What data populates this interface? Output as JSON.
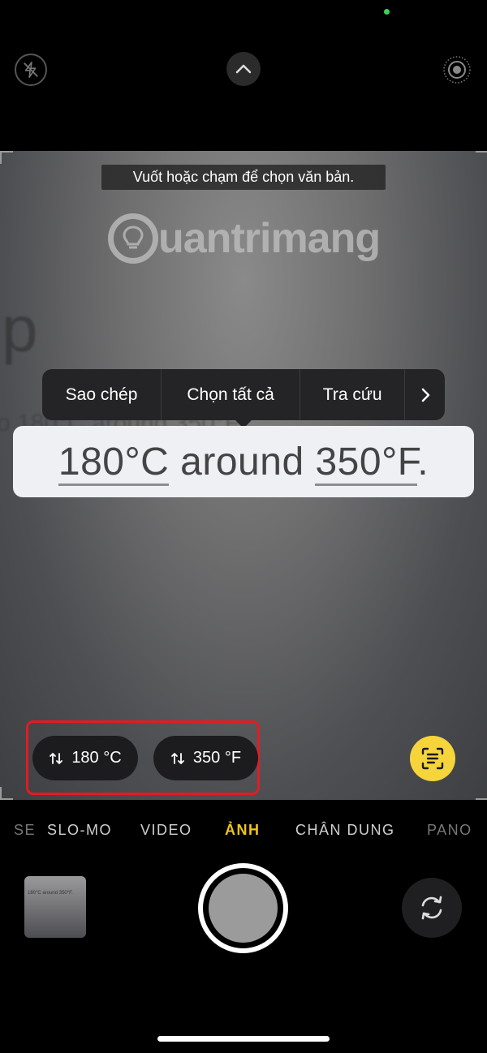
{
  "hint": "Vuốt hoặc chạm để chọn văn bản.",
  "watermark": "uantrimang",
  "background_text": {
    "letter": "p",
    "line": "o 180°C around 350°F"
  },
  "context_menu": {
    "items": [
      "Sao chép",
      "Chọn tất cả",
      "Tra cứu"
    ],
    "more": "›"
  },
  "selection": {
    "part1": "180°C",
    "part2": " around ",
    "part3": "350°F",
    "part4": "."
  },
  "conversions": [
    {
      "label": "180 °C"
    },
    {
      "label": "350 °F"
    }
  ],
  "modes": {
    "m0": "SE",
    "m1": "SLO-MO",
    "m2": "VIDEO",
    "m3": "ẢNH",
    "m4": "CHÂN DUNG",
    "m5": "PANO"
  },
  "thumbnail_text": "180°C around 350°F.",
  "colors": {
    "accent": "#f0c419",
    "live_text": "#f5d53b",
    "highlight_frame": "#e31b23"
  },
  "icons": [
    "flash-off-icon",
    "chevron-up-icon",
    "live-photo-icon",
    "convert-icon",
    "live-text-icon",
    "camera-flip-icon"
  ]
}
